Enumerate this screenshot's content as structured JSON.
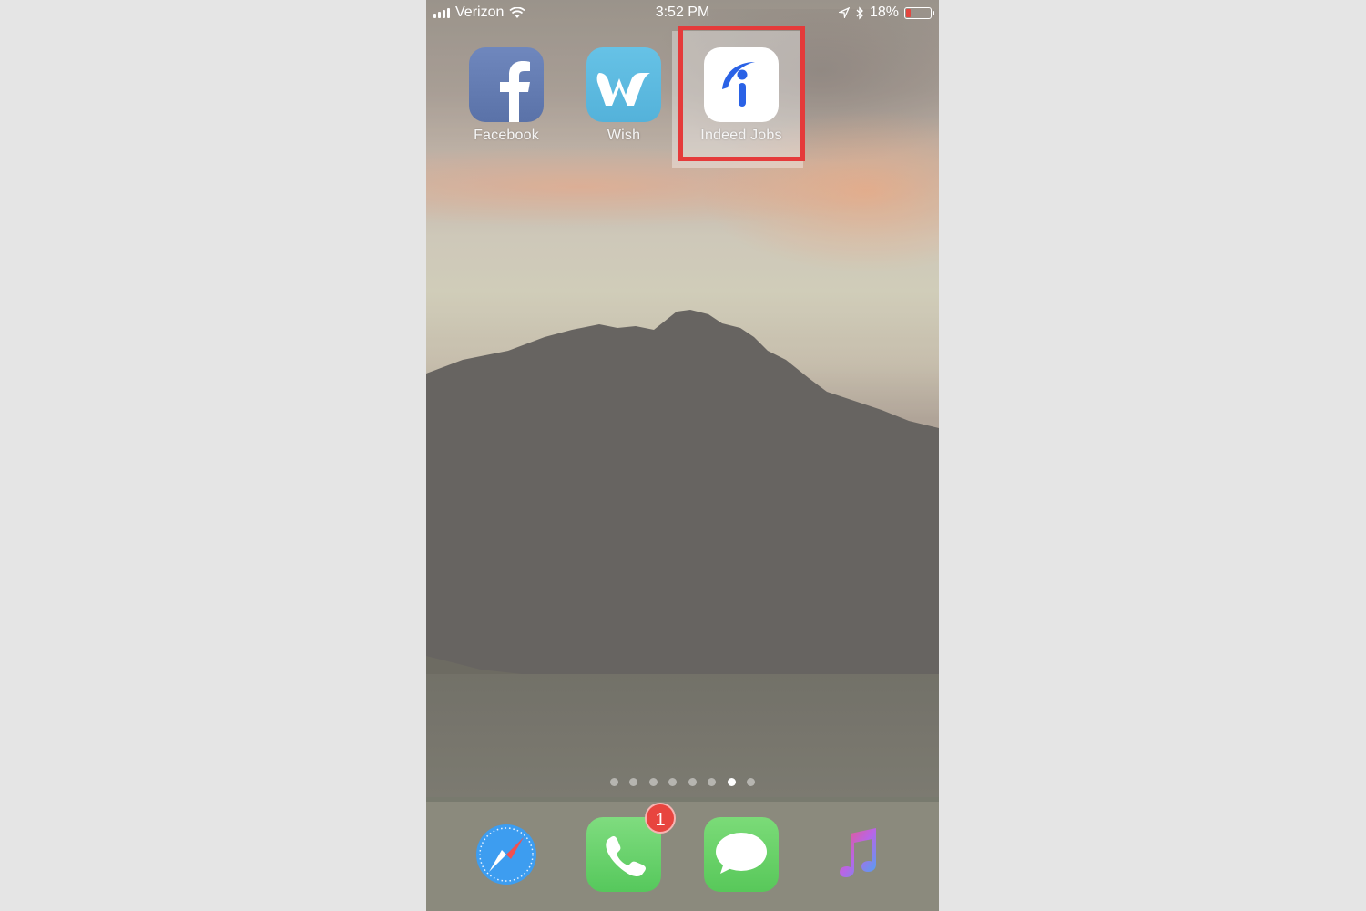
{
  "status_bar": {
    "carrier": "Verizon",
    "time": "3:52 PM",
    "battery_percent": "18%",
    "battery_level": 0.18,
    "icons": [
      "signal-icon",
      "wifi-icon",
      "location-icon",
      "bluetooth-icon",
      "battery-icon"
    ]
  },
  "home_apps": [
    {
      "label": "Facebook",
      "icon": "facebook-icon"
    },
    {
      "label": "Wish",
      "icon": "wish-icon"
    },
    {
      "label": "Indeed Jobs",
      "icon": "indeed-icon",
      "highlighted": true
    }
  ],
  "highlight_color": "#e53a3a",
  "page_indicator": {
    "count": 8,
    "active_index": 6
  },
  "dock": {
    "apps": [
      {
        "name": "Safari",
        "icon": "safari-icon"
      },
      {
        "name": "Phone",
        "icon": "phone-icon",
        "badge": "1"
      },
      {
        "name": "Messages",
        "icon": "messages-icon"
      },
      {
        "name": "Music",
        "icon": "music-icon"
      }
    ]
  }
}
